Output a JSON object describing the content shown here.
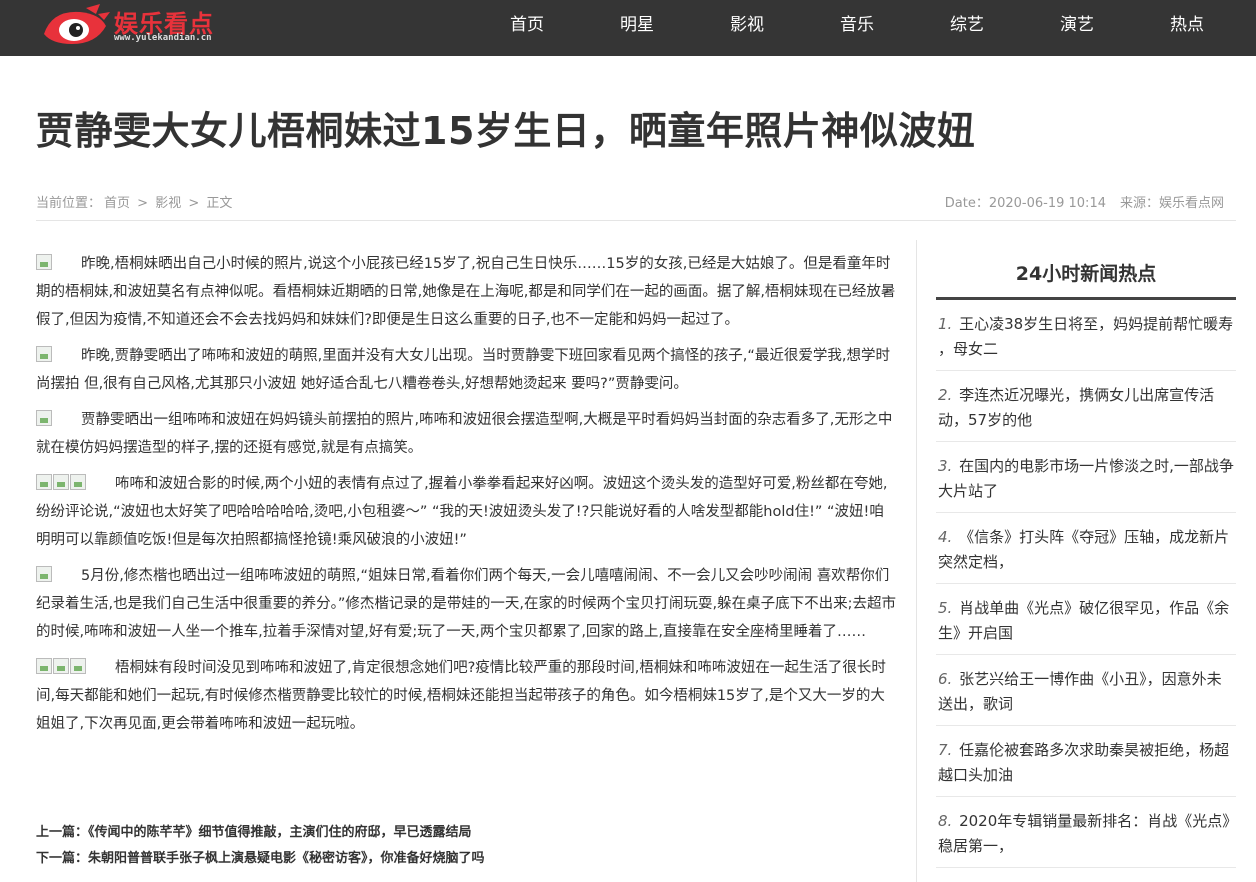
{
  "header": {
    "logo_text": "娱乐看点",
    "logo_url": "www.yulekandian.cn",
    "nav": [
      "首页",
      "明星",
      "影视",
      "音乐",
      "综艺",
      "演艺",
      "热点"
    ]
  },
  "article": {
    "title": "贾静雯大女儿梧桐妹过15岁生日，晒童年照片神似波妞",
    "breadcrumb": {
      "prefix": "当前位置：",
      "home": "首页",
      "sep": ">",
      "category": "影视",
      "current": "正文"
    },
    "date": "Date：2020-06-19 10:14",
    "source": "来源：娱乐看点网",
    "paragraphs": [
      {
        "images": 1,
        "text": "昨晚,梧桐妹晒出自己小时候的照片,说这个小屁孩已经15岁了,祝自己生日快乐……15岁的女孩,已经是大姑娘了。但是看童年时期的梧桐妹,和波妞莫名有点神似呢。看梧桐妹近期晒的日常,她像是在上海呢,都是和同学们在一起的画面。据了解,梧桐妹现在已经放暑假了,但因为疫情,不知道还会不会去找妈妈和妹妹们?即便是生日这么重要的日子,也不一定能和妈妈一起过了。"
      },
      {
        "images": 1,
        "text": "昨晚,贾静雯晒出了咘咘和波妞的萌照,里面并没有大女儿出现。当时贾静雯下班回家看见两个搞怪的孩子,“最近很爱学我,想学时尚摆拍 但,很有自己风格,尤其那只小波妞 她好适合乱七八糟卷卷头,好想帮她烫起来 要吗?”贾静雯问。"
      },
      {
        "images": 1,
        "text": "贾静雯晒出一组咘咘和波妞在妈妈镜头前摆拍的照片,咘咘和波妞很会摆造型啊,大概是平时看妈妈当封面的杂志看多了,无形之中就在模仿妈妈摆造型的样子,摆的还挺有感觉,就是有点搞笑。"
      },
      {
        "images": 3,
        "text": "咘咘和波妞合影的时候,两个小妞的表情有点过了,握着小拳拳看起来好凶啊。波妞这个烫头发的造型好可爱,粉丝都在夸她,纷纷评论说,“波妞也太好笑了吧哈哈哈哈哈,烫吧,小包租婆～”   “我的天!波妞烫头发了!?只能说好看的人啥发型都能hold住!”   “波妞!咱明明可以靠颜值吃饭!但是每次拍照都搞怪抢镜!乘风破浪的小波妞!”"
      },
      {
        "images": 1,
        "text": "5月份,修杰楷也晒出过一组咘咘波妞的萌照,“姐妹日常,看着你们两个每天,一会儿嘻嘻闹闹、不一会儿又会吵吵闹闹 喜欢帮你们纪录着生活,也是我们自己生活中很重要的养分。”修杰楷记录的是带娃的一天,在家的时候两个宝贝打闹玩耍,躲在桌子底下不出来;去超市的时候,咘咘和波妞一人坐一个推车,拉着手深情对望,好有爱;玩了一天,两个宝贝都累了,回家的路上,直接靠在安全座椅里睡着了……"
      },
      {
        "images": 3,
        "text": "梧桐妹有段时间没见到咘咘和波妞了,肯定很想念她们吧?疫情比较严重的那段时间,梧桐妹和咘咘波妞在一起生活了很长时间,每天都能和她们一起玩,有时候修杰楷贾静雯比较忙的时候,梧桐妹还能担当起带孩子的角色。如今梧桐妹15岁了,是个又大一岁的大姐姐了,下次再见面,更会带着咘咘和波妞一起玩啦。"
      }
    ],
    "prev": "上一篇：《传闻中的陈芊芊》细节值得推敲，主演们住的府邸，早已透露结局",
    "next": "下一篇：朱朝阳普普联手张子枫上演悬疑电影《秘密访客》，你准备好烧脑了吗"
  },
  "sidebar": {
    "title": "24小时新闻热点",
    "items": [
      {
        "num": "1.",
        "text": "王心凌38岁生日将至，妈妈提前帮忙暖寿 ，母女二"
      },
      {
        "num": "2.",
        "text": "李连杰近况曝光，携俩女儿出席宣传活动，57岁的他"
      },
      {
        "num": "3.",
        "text": "在国内的电影市场一片惨淡之时,一部战争大片站了"
      },
      {
        "num": "4.",
        "text": "《信条》打头阵《夺冠》压轴，成龙新片突然定档，"
      },
      {
        "num": "5.",
        "text": "肖战单曲《光点》破亿很罕见，作品《余生》开启国"
      },
      {
        "num": "6.",
        "text": "张艺兴给王一博作曲《小丑》，因意外未送出，歌词"
      },
      {
        "num": "7.",
        "text": "任嘉伦被套路多次求助秦昊被拒绝，杨超越口头加油"
      },
      {
        "num": "8.",
        "text": "2020年专辑销量最新排名：肖战《光点》稳居第一，"
      }
    ]
  }
}
